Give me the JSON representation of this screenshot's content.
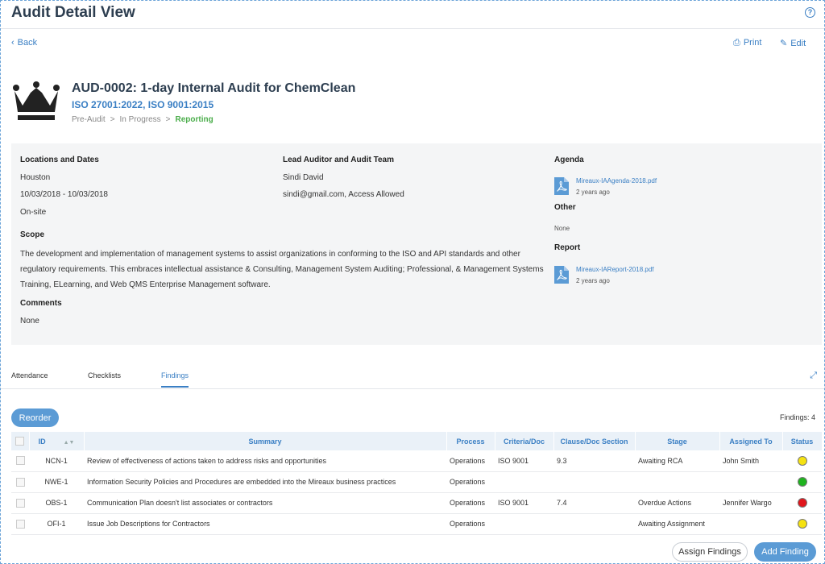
{
  "header": {
    "title": "Audit Detail View",
    "help_icon": "?"
  },
  "actions": {
    "back": "Back",
    "print": "Print",
    "edit": "Edit"
  },
  "audit": {
    "title": "AUD-0002: 1-day Internal Audit for ChemClean",
    "standards": "ISO 27001:2022, ISO 9001:2015",
    "stages": [
      "Pre-Audit",
      "In Progress",
      "Reporting"
    ],
    "stage_separator": ">"
  },
  "details": {
    "locations_heading": "Locations and Dates",
    "location": "Houston",
    "dates": "10/03/2018 - 10/03/2018",
    "site": "On-site",
    "lead_heading": "Lead Auditor and Audit Team",
    "lead_name": "Sindi David",
    "lead_contact": "sindi@gmail.com, Access Allowed",
    "scope_heading": "Scope",
    "scope_text": "The development and implementation of management systems to assist organizations in conforming to the ISO and API standards and other regulatory requirements. This embraces intellectual assistance & Consulting, Management System Auditing; Professional, & Management Systems Training, ELearning, and Web QMS Enterprise Management software.",
    "comments_heading": "Comments",
    "comments": "None",
    "agenda_heading": "Agenda",
    "agenda_file": "Mireaux-IAAgenda-2018.pdf",
    "agenda_age": "2 years ago",
    "other_heading": "Other",
    "other_value": "None",
    "report_heading": "Report",
    "report_file": "Mireaux-IAReport-2018.pdf",
    "report_age": "2 years ago"
  },
  "tabs": [
    "Attendance",
    "Checklists",
    "Findings"
  ],
  "toolbar": {
    "reorder": "Reorder",
    "findings_count": "Findings: 4"
  },
  "table": {
    "columns": [
      "ID",
      "Summary",
      "Process",
      "Criteria/Doc",
      "Clause/Doc Section",
      "Stage",
      "Assigned To",
      "Status"
    ],
    "rows": [
      {
        "id": "NCN-1",
        "summary": "Review of effectiveness of actions taken to address risks and opportunities",
        "process": "Operations",
        "criteria": "ISO 9001",
        "clause": "9.3",
        "stage": "Awaiting RCA",
        "assigned": "John Smith",
        "status_color": "#f5e211"
      },
      {
        "id": "NWE-1",
        "summary": "Information Security Policies and Procedures are embedded into the Mireaux business practices",
        "process": "Operations",
        "criteria": "",
        "clause": "",
        "stage": "",
        "assigned": "",
        "status_color": "#1fb31f"
      },
      {
        "id": "OBS-1",
        "summary": "Communication Plan doesn't list associates or contractors",
        "process": "Operations",
        "criteria": "ISO 9001",
        "clause": "7.4",
        "stage": "Overdue Actions",
        "assigned": "Jennifer Wargo",
        "status_color": "#e0161c"
      },
      {
        "id": "OFI-1",
        "summary": "Issue Job Descriptions for Contractors",
        "process": "Operations",
        "criteria": "",
        "clause": "",
        "stage": "Awaiting Assignment",
        "assigned": "",
        "status_color": "#f5e211"
      }
    ]
  },
  "footer": {
    "assign_findings": "Assign Findings",
    "add_finding": "Add Finding"
  }
}
